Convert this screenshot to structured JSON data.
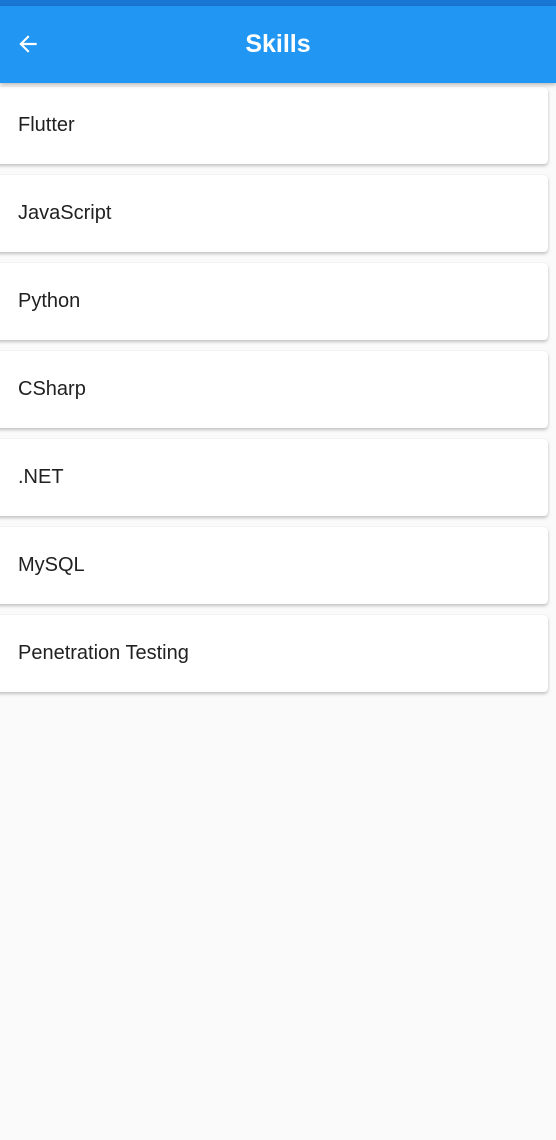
{
  "app_bar": {
    "title": "Skills",
    "back_icon": "arrow-back-icon",
    "color": "#2196f3",
    "status_color": "#1976d2"
  },
  "skills": [
    {
      "label": "Flutter"
    },
    {
      "label": "JavaScript"
    },
    {
      "label": "Python"
    },
    {
      "label": "CSharp"
    },
    {
      "label": ".NET"
    },
    {
      "label": "MySQL"
    },
    {
      "label": "Penetration Testing"
    }
  ]
}
